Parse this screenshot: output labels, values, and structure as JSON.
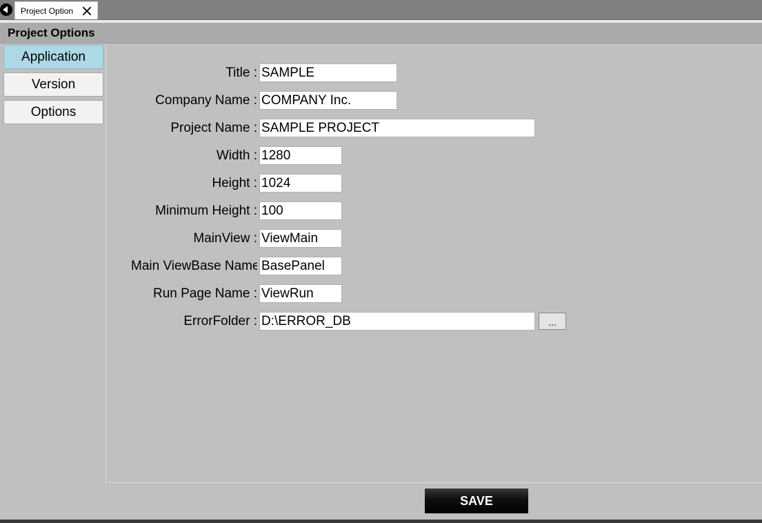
{
  "tab": {
    "label": "Project Option"
  },
  "header": {
    "title": "Project Options"
  },
  "sidebar": {
    "items": [
      {
        "label": "Application",
        "active": true
      },
      {
        "label": "Version",
        "active": false
      },
      {
        "label": "Options",
        "active": false
      }
    ]
  },
  "fields": [
    {
      "label": "Title :",
      "value": "SAMPLE"
    },
    {
      "label": "Company Name :",
      "value": "COMPANY Inc."
    },
    {
      "label": "Project Name :",
      "value": "SAMPLE PROJECT"
    },
    {
      "label": "Width :",
      "value": "1280"
    },
    {
      "label": "Height :",
      "value": "1024"
    },
    {
      "label": "Minimum Height :",
      "value": "100"
    },
    {
      "label": "MainView :",
      "value": "ViewMain"
    },
    {
      "label": "Main ViewBase Name :",
      "value": "BasePanel"
    },
    {
      "label": "Run Page Name :",
      "value": "ViewRun"
    },
    {
      "label": "ErrorFolder :",
      "value": "D:\\ERROR_DB"
    }
  ],
  "browse_label": "...",
  "save_label": "SAVE",
  "colors": {
    "active_sidebar": "#add8e6",
    "background": "#c0c0c0",
    "save_button": "#000000"
  }
}
